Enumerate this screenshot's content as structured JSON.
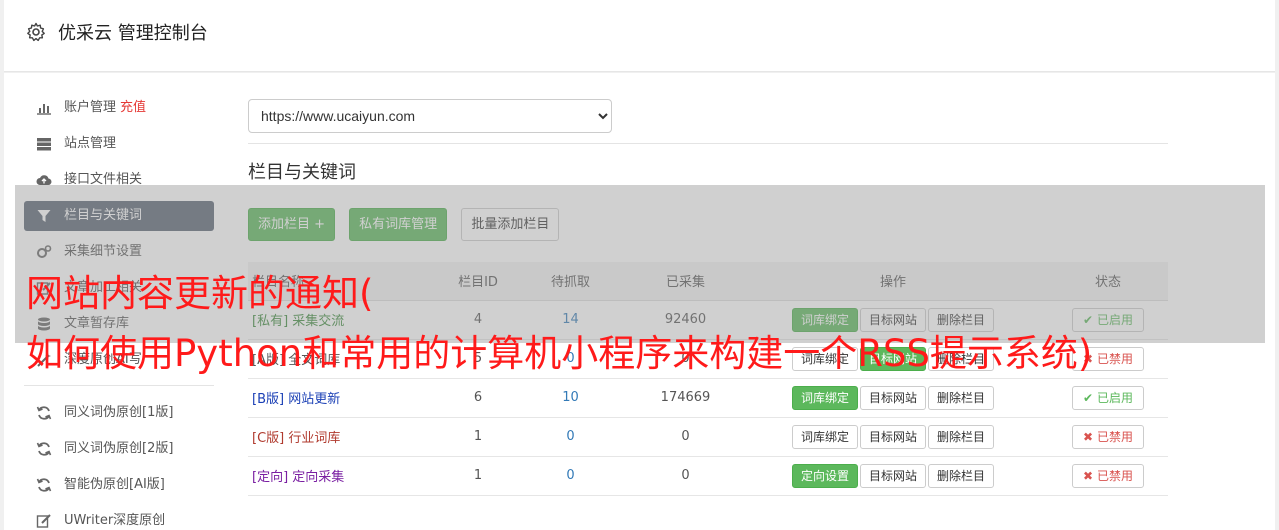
{
  "header": {
    "title": "优采云 管理控制台",
    "icon": "gear-icon"
  },
  "sidebar": {
    "items": [
      {
        "label": "账户管理",
        "extra": "充值",
        "icon": "bar-chart-icon"
      },
      {
        "label": "站点管理",
        "icon": "server-icon"
      },
      {
        "label": "接口文件相关",
        "icon": "cloud-upload-icon"
      },
      {
        "label": "栏目与关键词",
        "icon": "filter-icon",
        "active": true
      },
      {
        "label": "采集细节设置",
        "icon": "cogs-icon"
      },
      {
        "label": "文章加工相关",
        "icon": "edit-icon"
      },
      {
        "label": "文章暂存库",
        "icon": "database-icon"
      },
      {
        "label": "深度原创AI写",
        "icon": "magic-icon"
      }
    ],
    "items2": [
      {
        "label": "同义词伪原创[1版]",
        "icon": "refresh-icon"
      },
      {
        "label": "同义词伪原创[2版]",
        "icon": "refresh-icon"
      },
      {
        "label": "智能伪原创[AI版]",
        "icon": "refresh-icon"
      },
      {
        "label": "UWriter深度原创",
        "icon": "pencil-icon"
      }
    ]
  },
  "main": {
    "site_select": "https://www.ucaiyun.com",
    "section_title": "栏目与关键词",
    "buttons": {
      "add_column": "添加栏目 +",
      "private_lexicon": "私有词库管理",
      "batch_add": "批量添加栏目"
    },
    "table": {
      "headers": [
        "栏目名称",
        "栏目ID",
        "待抓取",
        "已采集",
        "操作",
        "状态"
      ],
      "rows": [
        {
          "tag": "[私有]",
          "name": "采集交流",
          "id": "4",
          "pending": "14",
          "collected": "92460",
          "op1": "词库绑定",
          "op2": "目标网站",
          "op3": "删除栏目",
          "status": "已启用"
        },
        {
          "tag": "[A版]",
          "name": "全文词库",
          "id": "5",
          "pending": "0",
          "collected": "0",
          "op1": "词库绑定",
          "op2": "目标网站",
          "op3": "删除栏目",
          "status": "已禁用"
        },
        {
          "tag": "[B版]",
          "name": "网站更新",
          "id": "6",
          "pending": "10",
          "collected": "174669",
          "op1": "词库绑定",
          "op2": "目标网站",
          "op3": "删除栏目",
          "status": "已启用"
        },
        {
          "tag": "[C版]",
          "name": "行业词库",
          "id": "1",
          "pending": "0",
          "collected": "0",
          "op1": "词库绑定",
          "op2": "目标网站",
          "op3": "删除栏目",
          "status": "已禁用"
        },
        {
          "tag": "[定向]",
          "name": "定向采集",
          "id": "1",
          "pending": "0",
          "collected": "0",
          "op1": "定向设置",
          "op2": "目标网站",
          "op3": "删除栏目",
          "status": "已禁用"
        }
      ]
    }
  },
  "overlay": {
    "line1": "网站内容更新的通知(",
    "line2": "如何使用Python和常用的计算机小程序来构建一个RSS提示系统)"
  },
  "colors": {
    "green": "#5cb85c",
    "red": "#d9534f",
    "link_blue": "#337ab7",
    "tag_private": "#3c8a3c",
    "tag_a": "#555555",
    "tag_b": "#1a3fb5",
    "tag_c": "#b03a2e",
    "tag_dir": "#7a1fa2",
    "headline_red": "#ff1a1a"
  }
}
